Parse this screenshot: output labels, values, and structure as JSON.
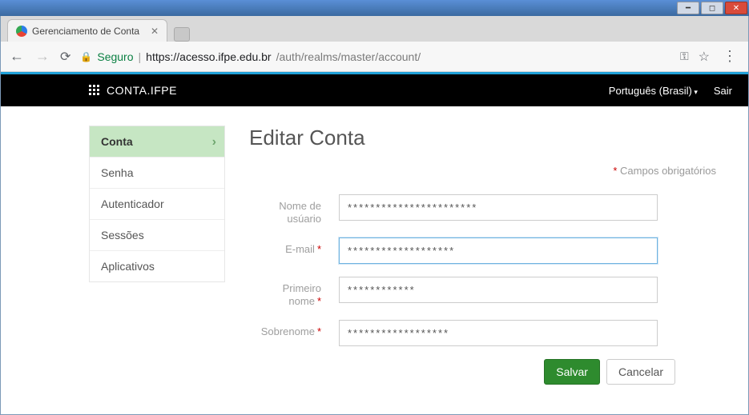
{
  "window": {
    "tab_title": "Gerenciamento de Conta",
    "secure_label": "Seguro",
    "url_host": "https://acesso.ifpe.edu.br",
    "url_path": "/auth/realms/master/account/"
  },
  "topbar": {
    "brand": "CONTA.IFPE",
    "language": "Português (Brasil)",
    "logout": "Sair"
  },
  "sidebar": {
    "items": [
      {
        "label": "Conta",
        "active": true
      },
      {
        "label": "Senha",
        "active": false
      },
      {
        "label": "Autenticador",
        "active": false
      },
      {
        "label": "Sessões",
        "active": false
      },
      {
        "label": "Aplicativos",
        "active": false
      }
    ]
  },
  "form": {
    "title": "Editar Conta",
    "required_note": "Campos obrigatórios",
    "fields": {
      "username": {
        "label": "Nome de usúario",
        "value": "***********************",
        "required": false
      },
      "email": {
        "label": "E-mail",
        "value": "*******************",
        "required": true
      },
      "first": {
        "label": "Primeiro nome",
        "value": "************",
        "required": true
      },
      "last": {
        "label": "Sobrenome",
        "value": "******************",
        "required": true
      }
    },
    "save_label": "Salvar",
    "cancel_label": "Cancelar"
  }
}
